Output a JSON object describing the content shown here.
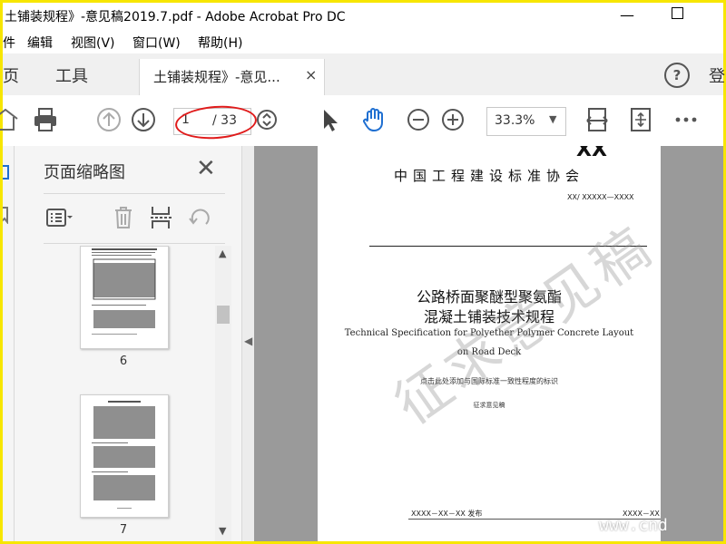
{
  "window": {
    "title": "土铺装规程》-意见稿2019.7.pdf - Adobe Acrobat Pro DC",
    "minimize_glyph": "—"
  },
  "menu": [
    "件",
    "编辑",
    "视图(V)",
    "窗口(W)",
    "帮助(H)"
  ],
  "tabs": {
    "home": "页",
    "tools": "工具",
    "document": "土铺装规程》-意见...",
    "close_glyph": "×",
    "help": "?",
    "login": "登"
  },
  "toolbar": {
    "current_page": "1",
    "total_pages": "/ 33",
    "zoom": "33.3%",
    "zoom_caret": "▼"
  },
  "panel": {
    "title": "页面缩略图",
    "close_glyph": "✕",
    "thumbnails": [
      {
        "page_label": "6"
      },
      {
        "page_label": "7"
      }
    ]
  },
  "document": {
    "header_code": "XX",
    "organization": "中国工程建设标准协会",
    "standard_number": "XX/ XXXXX—XXXX",
    "title_line1": "公路桥面聚醚型聚氨酯",
    "title_line2": "混凝土铺装技术规程",
    "english_line1": "Technical Specification for Polyether Polymer Concrete Layout",
    "english_line2": "on Road Deck",
    "consistency_note": "点击此处添加与国际标准一致性程度的标识",
    "draft_label": "征求意见稿",
    "publish_date": "XXXX－XX－XX 发布",
    "implement_date": "XXXX－XX－",
    "watermark": "征求意见稿",
    "site_watermark": "www.cnd"
  },
  "colors": {
    "frame": "#f7e600",
    "annotation_ellipse": "#e01b1b",
    "doc_background": "#9a9a9a",
    "hand_tool": "#1f6fd1"
  }
}
